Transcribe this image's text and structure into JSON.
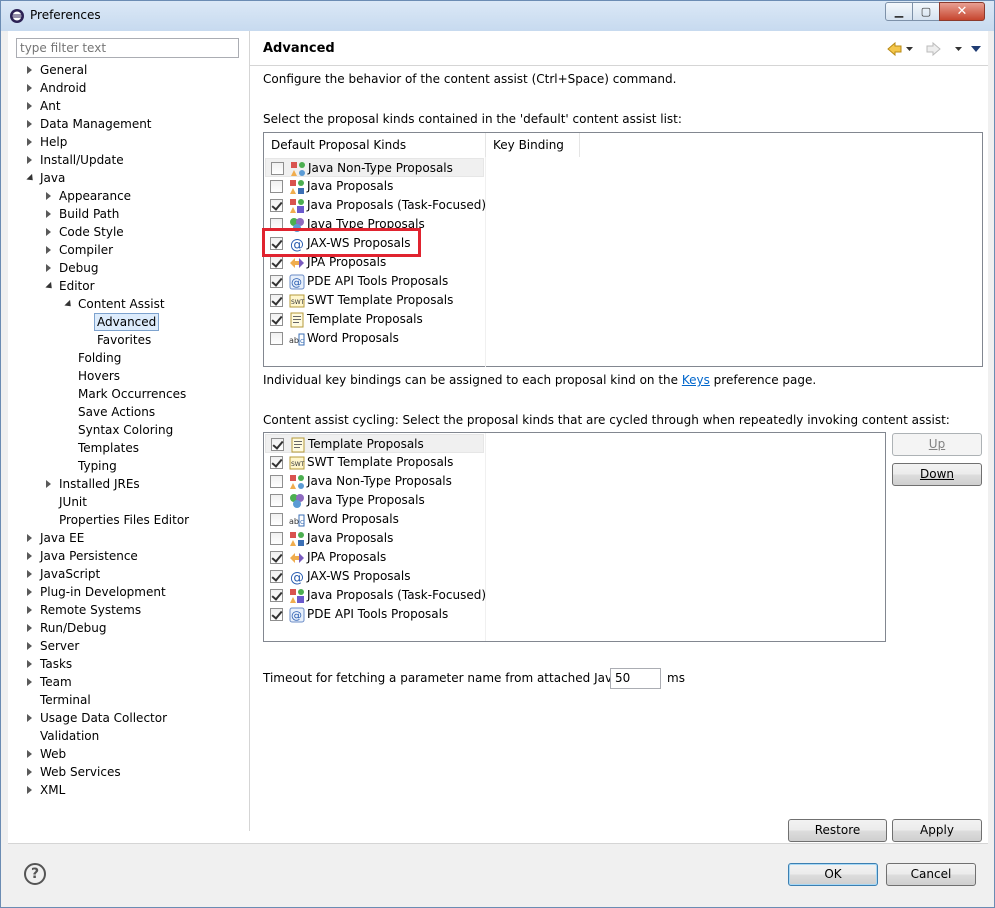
{
  "window": {
    "title": "Preferences"
  },
  "filter": {
    "placeholder": "type filter text"
  },
  "tree": [
    {
      "label": "General",
      "depth": 0,
      "twisty": "closed"
    },
    {
      "label": "Android",
      "depth": 0,
      "twisty": "closed"
    },
    {
      "label": "Ant",
      "depth": 0,
      "twisty": "closed"
    },
    {
      "label": "Data Management",
      "depth": 0,
      "twisty": "closed"
    },
    {
      "label": "Help",
      "depth": 0,
      "twisty": "closed"
    },
    {
      "label": "Install/Update",
      "depth": 0,
      "twisty": "closed"
    },
    {
      "label": "Java",
      "depth": 0,
      "twisty": "open"
    },
    {
      "label": "Appearance",
      "depth": 1,
      "twisty": "closed"
    },
    {
      "label": "Build Path",
      "depth": 1,
      "twisty": "closed"
    },
    {
      "label": "Code Style",
      "depth": 1,
      "twisty": "closed"
    },
    {
      "label": "Compiler",
      "depth": 1,
      "twisty": "closed"
    },
    {
      "label": "Debug",
      "depth": 1,
      "twisty": "closed"
    },
    {
      "label": "Editor",
      "depth": 1,
      "twisty": "open"
    },
    {
      "label": "Content Assist",
      "depth": 2,
      "twisty": "open"
    },
    {
      "label": "Advanced",
      "depth": 3,
      "twisty": "none",
      "selected": true
    },
    {
      "label": "Favorites",
      "depth": 3,
      "twisty": "none"
    },
    {
      "label": "Folding",
      "depth": 2,
      "twisty": "none"
    },
    {
      "label": "Hovers",
      "depth": 2,
      "twisty": "none"
    },
    {
      "label": "Mark Occurrences",
      "depth": 2,
      "twisty": "none"
    },
    {
      "label": "Save Actions",
      "depth": 2,
      "twisty": "none"
    },
    {
      "label": "Syntax Coloring",
      "depth": 2,
      "twisty": "none"
    },
    {
      "label": "Templates",
      "depth": 2,
      "twisty": "none"
    },
    {
      "label": "Typing",
      "depth": 2,
      "twisty": "none"
    },
    {
      "label": "Installed JREs",
      "depth": 1,
      "twisty": "closed"
    },
    {
      "label": "JUnit",
      "depth": 1,
      "twisty": "none"
    },
    {
      "label": "Properties Files Editor",
      "depth": 1,
      "twisty": "none"
    },
    {
      "label": "Java EE",
      "depth": 0,
      "twisty": "closed"
    },
    {
      "label": "Java Persistence",
      "depth": 0,
      "twisty": "closed"
    },
    {
      "label": "JavaScript",
      "depth": 0,
      "twisty": "closed"
    },
    {
      "label": "Plug-in Development",
      "depth": 0,
      "twisty": "closed"
    },
    {
      "label": "Remote Systems",
      "depth": 0,
      "twisty": "closed"
    },
    {
      "label": "Run/Debug",
      "depth": 0,
      "twisty": "closed"
    },
    {
      "label": "Server",
      "depth": 0,
      "twisty": "closed"
    },
    {
      "label": "Tasks",
      "depth": 0,
      "twisty": "closed"
    },
    {
      "label": "Team",
      "depth": 0,
      "twisty": "closed"
    },
    {
      "label": "Terminal",
      "depth": 0,
      "twisty": "none"
    },
    {
      "label": "Usage Data Collector",
      "depth": 0,
      "twisty": "closed"
    },
    {
      "label": "Validation",
      "depth": 0,
      "twisty": "none"
    },
    {
      "label": "Web",
      "depth": 0,
      "twisty": "closed"
    },
    {
      "label": "Web Services",
      "depth": 0,
      "twisty": "closed"
    },
    {
      "label": "XML",
      "depth": 0,
      "twisty": "closed"
    }
  ],
  "page": {
    "title": "Advanced",
    "description": "Configure the behavior of the content assist (Ctrl+Space) command.",
    "default_list_label": "Select the proposal kinds contained in the 'default' content assist list:",
    "columns": [
      "Default Proposal Kinds",
      "Key Binding"
    ],
    "default_list": [
      {
        "label": "Java Non-Type Proposals",
        "checked": false,
        "icon": "java-nontype-icon"
      },
      {
        "label": "Java Proposals",
        "checked": false,
        "icon": "java-proposals-icon"
      },
      {
        "label": "Java Proposals (Task-Focused)",
        "checked": true,
        "icon": "java-task-focused-icon"
      },
      {
        "label": "Java Type Proposals",
        "checked": false,
        "icon": "java-type-icon"
      },
      {
        "label": "JAX-WS Proposals",
        "checked": true,
        "icon": "at-sign-icon"
      },
      {
        "label": "JPA Proposals",
        "checked": true,
        "icon": "jpa-arrows-icon"
      },
      {
        "label": "PDE API Tools Proposals",
        "checked": true,
        "icon": "pde-api-icon"
      },
      {
        "label": "SWT Template Proposals",
        "checked": true,
        "icon": "swt-template-icon"
      },
      {
        "label": "Template Proposals",
        "checked": true,
        "icon": "template-icon"
      },
      {
        "label": "Word Proposals",
        "checked": false,
        "icon": "word-abc-icon"
      }
    ],
    "keys_note_prefix": "Individual key bindings can be assigned to each proposal kind on the ",
    "keys_link": "Keys",
    "keys_note_suffix": " preference page.",
    "cycling_label": "Content assist cycling: Select the proposal kinds that are cycled through when repeatedly invoking content assist:",
    "cycling_list": [
      {
        "label": "Template Proposals",
        "checked": true,
        "icon": "template-icon"
      },
      {
        "label": "SWT Template Proposals",
        "checked": true,
        "icon": "swt-template-icon"
      },
      {
        "label": "Java Non-Type Proposals",
        "checked": false,
        "icon": "java-nontype-icon"
      },
      {
        "label": "Java Type Proposals",
        "checked": false,
        "icon": "java-type-icon"
      },
      {
        "label": "Word Proposals",
        "checked": false,
        "icon": "word-abc-icon"
      },
      {
        "label": "Java Proposals",
        "checked": false,
        "icon": "java-proposals-icon"
      },
      {
        "label": "JPA Proposals",
        "checked": true,
        "icon": "jpa-arrows-icon"
      },
      {
        "label": "JAX-WS Proposals",
        "checked": true,
        "icon": "at-sign-icon"
      },
      {
        "label": "Java Proposals (Task-Focused)",
        "checked": true,
        "icon": "java-task-focused-icon"
      },
      {
        "label": "PDE API Tools Proposals",
        "checked": true,
        "icon": "pde-api-icon"
      }
    ],
    "up_label": "Up",
    "down_label": "Down",
    "timeout_label": "Timeout for fetching a parameter name from attached Javadoc:",
    "timeout_value": "50",
    "timeout_unit": "ms",
    "restore_label": "Restore Defaults",
    "apply_label": "Apply"
  },
  "footer": {
    "ok_label": "OK",
    "cancel_label": "Cancel"
  },
  "colors": {
    "highlight": "#e0232f",
    "link": "#0066cc",
    "selection": "#ddecfc"
  }
}
